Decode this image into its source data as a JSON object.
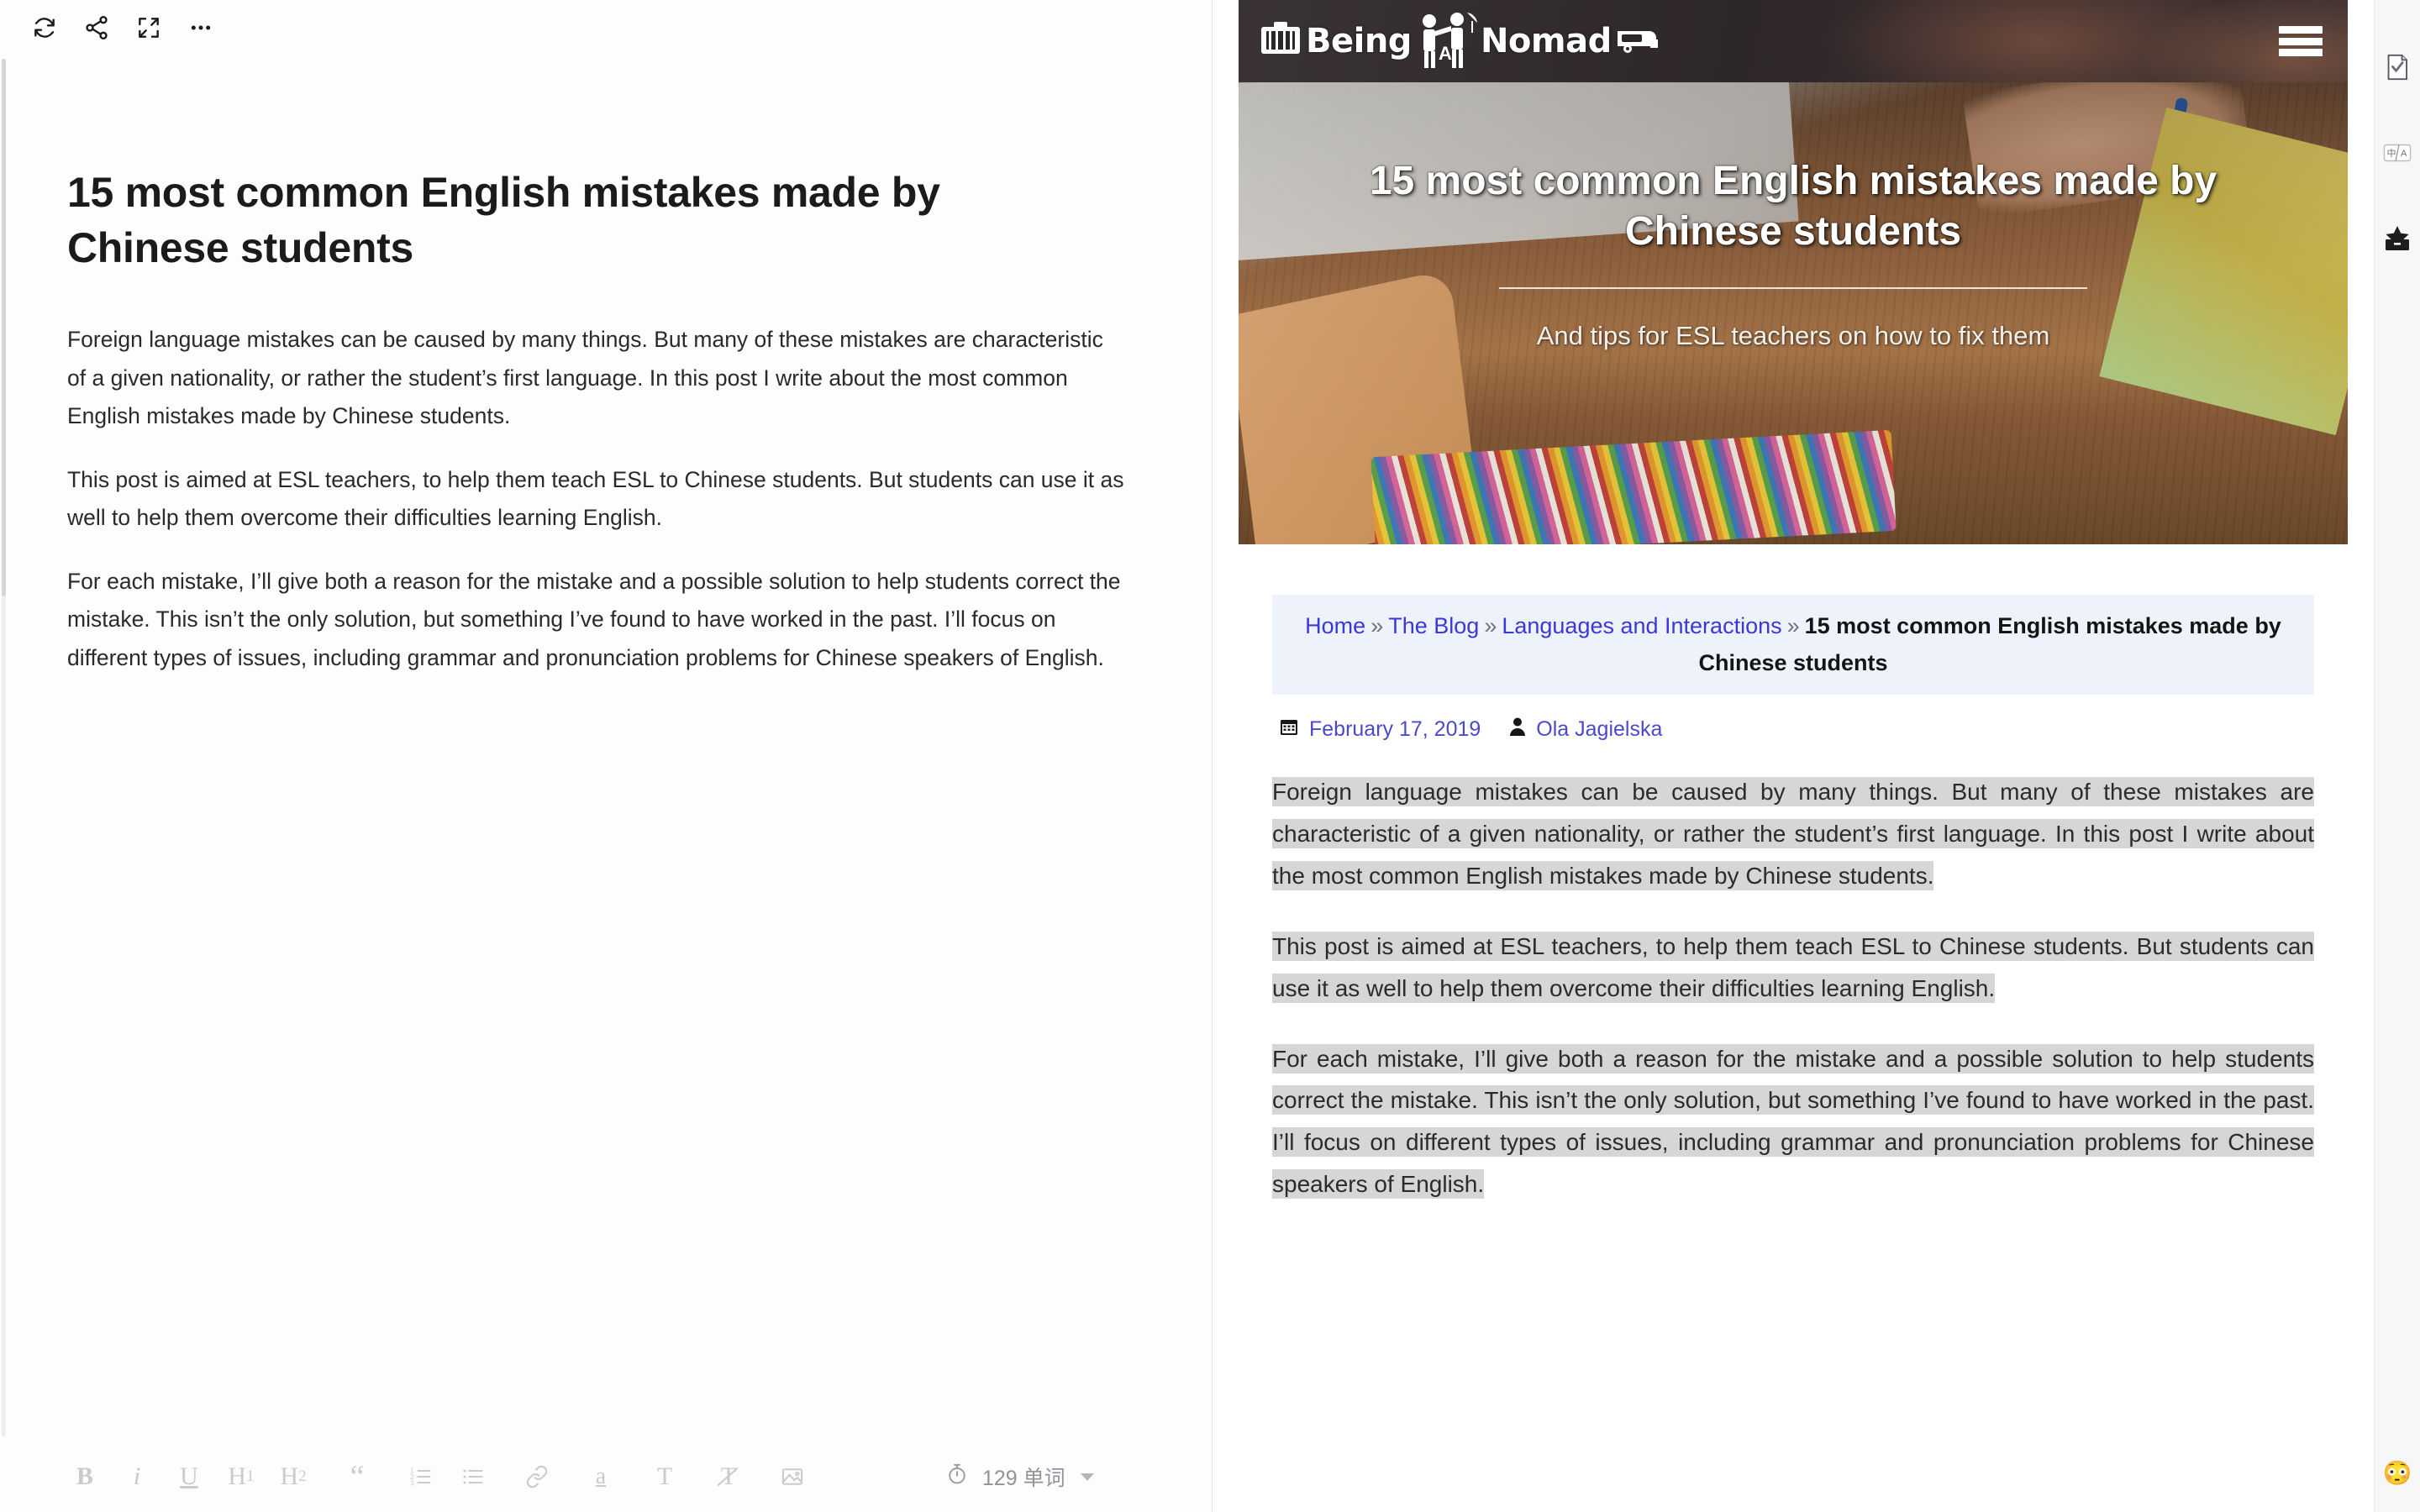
{
  "editor": {
    "toolbar_top": [
      {
        "name": "sync-icon",
        "label": "Sync"
      },
      {
        "name": "share-icon",
        "label": "Share"
      },
      {
        "name": "fullscreen-icon",
        "label": "Fullscreen"
      },
      {
        "name": "more-icon",
        "label": "More"
      }
    ],
    "title": "15 most common English mistakes made by Chinese students",
    "paragraphs": [
      "Foreign language mistakes can be caused by many things. But many of these mistakes are characteristic of a given nationality, or rather the student’s first language. In this post I write about the most common English mistakes made by Chinese students.",
      "This post is aimed at ESL teachers, to help them teach ESL to Chinese students. But students can use it as well to help them overcome their difficulties learning English.",
      "For each mistake, I’ll give both a reason for the mistake and a possible solution to help students correct the mistake. This isn’t the only solution, but something I’ve found to have worked in the past. I’ll focus on different types of issues, including grammar and pronunciation problems for Chinese speakers of English."
    ],
    "format_toolbar": [
      {
        "name": "bold-button",
        "label": "B"
      },
      {
        "name": "italic-button",
        "label": "i"
      },
      {
        "name": "underline-button",
        "label": "U"
      },
      {
        "name": "heading-1-button",
        "label": "H",
        "sub": "1"
      },
      {
        "name": "heading-2-button",
        "label": "H",
        "sub": "2"
      },
      {
        "name": "blockquote-button",
        "label": "“"
      },
      {
        "name": "ordered-list-button",
        "label": ""
      },
      {
        "name": "unordered-list-button",
        "label": ""
      },
      {
        "name": "link-button",
        "label": ""
      },
      {
        "name": "highlight-button",
        "label": "a"
      },
      {
        "name": "text-color-button",
        "label": "T"
      },
      {
        "name": "clear-format-button",
        "label": "T"
      },
      {
        "name": "insert-image-button",
        "label": ""
      }
    ],
    "word_count": "129 单词"
  },
  "preview": {
    "site_logo": "Being A Nomad",
    "hero": {
      "title": "15 most common English mistakes made by Chinese students",
      "subtitle": "And tips for ESL teachers on how to fix them"
    },
    "breadcrumb": {
      "items": [
        {
          "label": "Home",
          "link": true
        },
        {
          "label": "The Blog",
          "link": true
        },
        {
          "label": "Languages and Interactions",
          "link": true
        }
      ],
      "separator": "»",
      "current": "15 most common English mistakes made by Chinese students"
    },
    "meta": {
      "date_icon": "calendar-icon",
      "date": "February 17, 2019",
      "author_icon": "user-icon",
      "author": "Ola Jagielska"
    },
    "paragraphs": [
      "Foreign language mistakes can be caused by many things. But many of these mistakes are characteristic of a given nationality, or rather the student’s first language. In this post I write about the most common English mistakes made by Chinese students.",
      "This post is aimed at ESL teachers, to help them teach ESL to Chinese students. But students can use it as well to help them overcome their difficulties learning English.",
      "For each mistake, I’ll give both a reason for the mistake and a possible solution to help students correct the mistake. This isn’t the only solution, but something I’ve found to have worked in the past. I’ll focus on different types of issues, including grammar and pronunciation problems for Chinese speakers of English."
    ]
  },
  "right_rail": {
    "items": [
      {
        "name": "checklist-icon",
        "label": "Proofread"
      },
      {
        "name": "translate-icon",
        "label": "中/A"
      },
      {
        "name": "collection-icon",
        "label": "Collection"
      }
    ],
    "emoji": "😳"
  },
  "colors": {
    "accent_link": "#3a39d6",
    "breadcrumb_bg": "#eef2fb",
    "selection_bg": "#d6d6d6",
    "header_bg": "#2b2829"
  }
}
